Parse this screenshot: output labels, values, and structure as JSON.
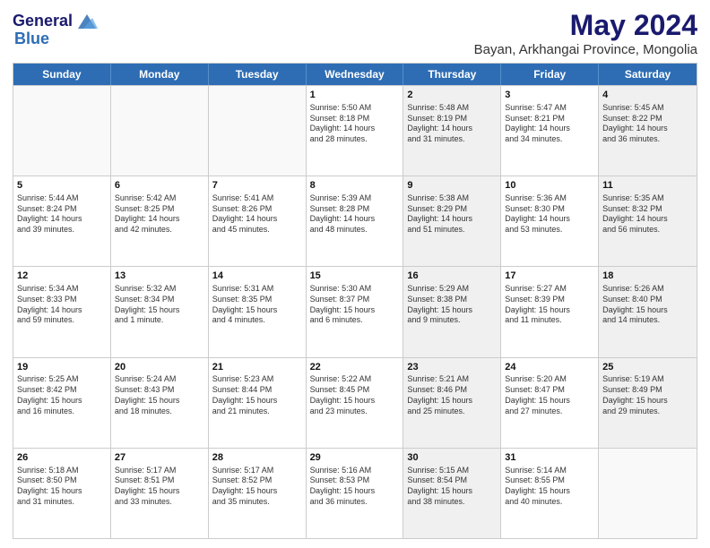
{
  "header": {
    "logo_line1": "General",
    "logo_line2": "Blue",
    "month_title": "May 2024",
    "subtitle": "Bayan, Arkhangai Province, Mongolia"
  },
  "days_of_week": [
    "Sunday",
    "Monday",
    "Tuesday",
    "Wednesday",
    "Thursday",
    "Friday",
    "Saturday"
  ],
  "rows": [
    [
      {
        "day": "",
        "lines": [],
        "empty": true
      },
      {
        "day": "",
        "lines": [],
        "empty": true
      },
      {
        "day": "",
        "lines": [],
        "empty": true
      },
      {
        "day": "1",
        "lines": [
          "Sunrise: 5:50 AM",
          "Sunset: 8:18 PM",
          "Daylight: 14 hours",
          "and 28 minutes."
        ],
        "shaded": false
      },
      {
        "day": "2",
        "lines": [
          "Sunrise: 5:48 AM",
          "Sunset: 8:19 PM",
          "Daylight: 14 hours",
          "and 31 minutes."
        ],
        "shaded": true
      },
      {
        "day": "3",
        "lines": [
          "Sunrise: 5:47 AM",
          "Sunset: 8:21 PM",
          "Daylight: 14 hours",
          "and 34 minutes."
        ],
        "shaded": false
      },
      {
        "day": "4",
        "lines": [
          "Sunrise: 5:45 AM",
          "Sunset: 8:22 PM",
          "Daylight: 14 hours",
          "and 36 minutes."
        ],
        "shaded": true
      }
    ],
    [
      {
        "day": "5",
        "lines": [
          "Sunrise: 5:44 AM",
          "Sunset: 8:24 PM",
          "Daylight: 14 hours",
          "and 39 minutes."
        ],
        "shaded": false
      },
      {
        "day": "6",
        "lines": [
          "Sunrise: 5:42 AM",
          "Sunset: 8:25 PM",
          "Daylight: 14 hours",
          "and 42 minutes."
        ],
        "shaded": false
      },
      {
        "day": "7",
        "lines": [
          "Sunrise: 5:41 AM",
          "Sunset: 8:26 PM",
          "Daylight: 14 hours",
          "and 45 minutes."
        ],
        "shaded": false
      },
      {
        "day": "8",
        "lines": [
          "Sunrise: 5:39 AM",
          "Sunset: 8:28 PM",
          "Daylight: 14 hours",
          "and 48 minutes."
        ],
        "shaded": false
      },
      {
        "day": "9",
        "lines": [
          "Sunrise: 5:38 AM",
          "Sunset: 8:29 PM",
          "Daylight: 14 hours",
          "and 51 minutes."
        ],
        "shaded": true
      },
      {
        "day": "10",
        "lines": [
          "Sunrise: 5:36 AM",
          "Sunset: 8:30 PM",
          "Daylight: 14 hours",
          "and 53 minutes."
        ],
        "shaded": false
      },
      {
        "day": "11",
        "lines": [
          "Sunrise: 5:35 AM",
          "Sunset: 8:32 PM",
          "Daylight: 14 hours",
          "and 56 minutes."
        ],
        "shaded": true
      }
    ],
    [
      {
        "day": "12",
        "lines": [
          "Sunrise: 5:34 AM",
          "Sunset: 8:33 PM",
          "Daylight: 14 hours",
          "and 59 minutes."
        ],
        "shaded": false
      },
      {
        "day": "13",
        "lines": [
          "Sunrise: 5:32 AM",
          "Sunset: 8:34 PM",
          "Daylight: 15 hours",
          "and 1 minute."
        ],
        "shaded": false
      },
      {
        "day": "14",
        "lines": [
          "Sunrise: 5:31 AM",
          "Sunset: 8:35 PM",
          "Daylight: 15 hours",
          "and 4 minutes."
        ],
        "shaded": false
      },
      {
        "day": "15",
        "lines": [
          "Sunrise: 5:30 AM",
          "Sunset: 8:37 PM",
          "Daylight: 15 hours",
          "and 6 minutes."
        ],
        "shaded": false
      },
      {
        "day": "16",
        "lines": [
          "Sunrise: 5:29 AM",
          "Sunset: 8:38 PM",
          "Daylight: 15 hours",
          "and 9 minutes."
        ],
        "shaded": true
      },
      {
        "day": "17",
        "lines": [
          "Sunrise: 5:27 AM",
          "Sunset: 8:39 PM",
          "Daylight: 15 hours",
          "and 11 minutes."
        ],
        "shaded": false
      },
      {
        "day": "18",
        "lines": [
          "Sunrise: 5:26 AM",
          "Sunset: 8:40 PM",
          "Daylight: 15 hours",
          "and 14 minutes."
        ],
        "shaded": true
      }
    ],
    [
      {
        "day": "19",
        "lines": [
          "Sunrise: 5:25 AM",
          "Sunset: 8:42 PM",
          "Daylight: 15 hours",
          "and 16 minutes."
        ],
        "shaded": false
      },
      {
        "day": "20",
        "lines": [
          "Sunrise: 5:24 AM",
          "Sunset: 8:43 PM",
          "Daylight: 15 hours",
          "and 18 minutes."
        ],
        "shaded": false
      },
      {
        "day": "21",
        "lines": [
          "Sunrise: 5:23 AM",
          "Sunset: 8:44 PM",
          "Daylight: 15 hours",
          "and 21 minutes."
        ],
        "shaded": false
      },
      {
        "day": "22",
        "lines": [
          "Sunrise: 5:22 AM",
          "Sunset: 8:45 PM",
          "Daylight: 15 hours",
          "and 23 minutes."
        ],
        "shaded": false
      },
      {
        "day": "23",
        "lines": [
          "Sunrise: 5:21 AM",
          "Sunset: 8:46 PM",
          "Daylight: 15 hours",
          "and 25 minutes."
        ],
        "shaded": true
      },
      {
        "day": "24",
        "lines": [
          "Sunrise: 5:20 AM",
          "Sunset: 8:47 PM",
          "Daylight: 15 hours",
          "and 27 minutes."
        ],
        "shaded": false
      },
      {
        "day": "25",
        "lines": [
          "Sunrise: 5:19 AM",
          "Sunset: 8:49 PM",
          "Daylight: 15 hours",
          "and 29 minutes."
        ],
        "shaded": true
      }
    ],
    [
      {
        "day": "26",
        "lines": [
          "Sunrise: 5:18 AM",
          "Sunset: 8:50 PM",
          "Daylight: 15 hours",
          "and 31 minutes."
        ],
        "shaded": false
      },
      {
        "day": "27",
        "lines": [
          "Sunrise: 5:17 AM",
          "Sunset: 8:51 PM",
          "Daylight: 15 hours",
          "and 33 minutes."
        ],
        "shaded": false
      },
      {
        "day": "28",
        "lines": [
          "Sunrise: 5:17 AM",
          "Sunset: 8:52 PM",
          "Daylight: 15 hours",
          "and 35 minutes."
        ],
        "shaded": false
      },
      {
        "day": "29",
        "lines": [
          "Sunrise: 5:16 AM",
          "Sunset: 8:53 PM",
          "Daylight: 15 hours",
          "and 36 minutes."
        ],
        "shaded": false
      },
      {
        "day": "30",
        "lines": [
          "Sunrise: 5:15 AM",
          "Sunset: 8:54 PM",
          "Daylight: 15 hours",
          "and 38 minutes."
        ],
        "shaded": true
      },
      {
        "day": "31",
        "lines": [
          "Sunrise: 5:14 AM",
          "Sunset: 8:55 PM",
          "Daylight: 15 hours",
          "and 40 minutes."
        ],
        "shaded": false
      },
      {
        "day": "",
        "lines": [],
        "empty": true
      }
    ]
  ]
}
